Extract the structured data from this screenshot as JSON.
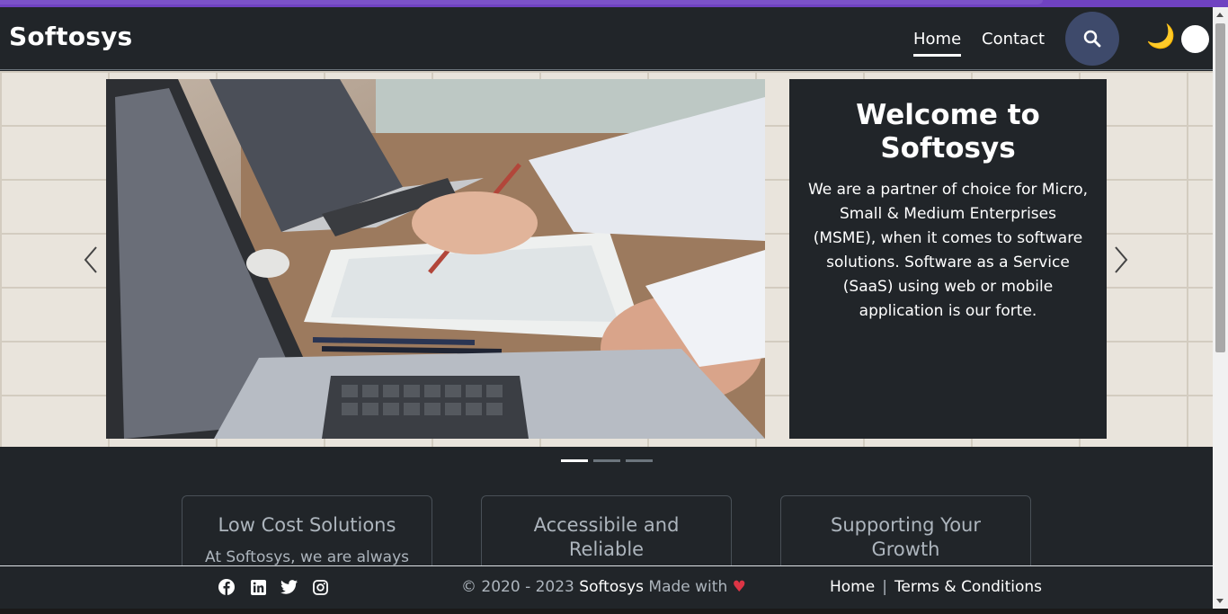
{
  "header": {
    "brand": "Softosys",
    "nav": [
      {
        "label": "Home",
        "active": true
      },
      {
        "label": "Contact",
        "active": false
      }
    ],
    "search_icon": "search-icon",
    "theme_icon": "🌙"
  },
  "hero": {
    "title": "Welcome to Softosys",
    "text": "We are a partner of choice for Micro, Small & Medium Enterprises (MSME), when it comes to software solutions. Software as a Service (SaaS) using web or mobile application is our forte.",
    "slides": 3,
    "active_slide": 1
  },
  "features": [
    {
      "title": "Low Cost Solutions",
      "text": "At Softosys, we are always"
    },
    {
      "title": "Accessibile and Reliable",
      "text": ""
    },
    {
      "title": "Supporting Your Growth",
      "text": ""
    }
  ],
  "footer": {
    "social": [
      "facebook-icon",
      "linkedin-icon",
      "twitter-icon",
      "instagram-icon"
    ],
    "copyright_prefix": "© 2020 - 2023",
    "brand": "Softosys",
    "made_with": "Made with",
    "heart": "♥",
    "links": [
      "Home",
      "Terms & Conditions"
    ],
    "separator": "|"
  },
  "colors": {
    "accent": "#6f42c1",
    "background": "#212529",
    "search_button": "#3e4a6b",
    "heart": "#dc3545"
  }
}
